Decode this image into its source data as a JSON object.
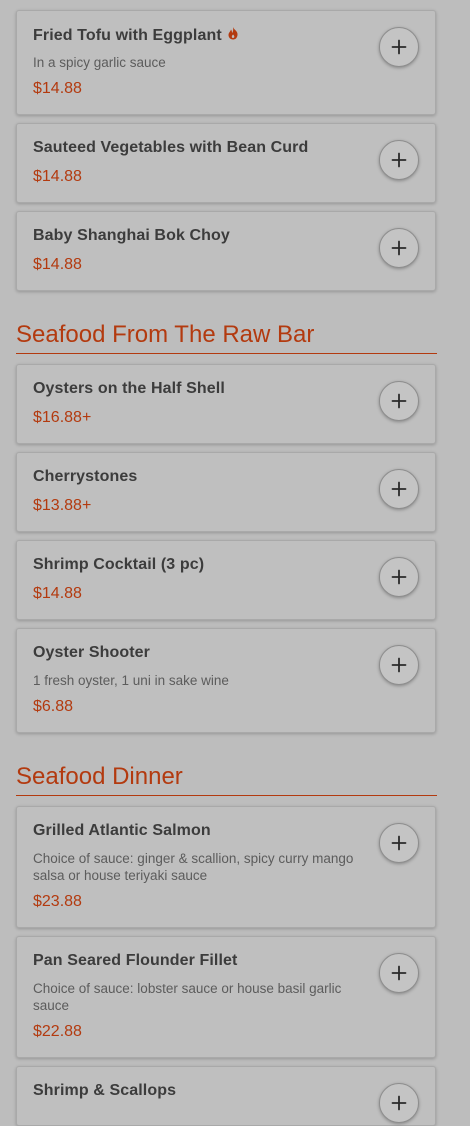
{
  "vegetable_items": [
    {
      "name": "Fried Tofu with Eggplant",
      "description": "In a spicy garlic sauce",
      "price": "$14.88",
      "spicy_icon": "flame-icon"
    },
    {
      "name": "Sauteed Vegetables with Bean Curd",
      "price": "$14.88"
    },
    {
      "name": "Baby Shanghai Bok Choy",
      "price": "$14.88"
    }
  ],
  "raw_bar": {
    "title": "Seafood From The Raw Bar",
    "items": [
      {
        "name": "Oysters on the Half Shell",
        "price": "$16.88+"
      },
      {
        "name": "Cherrystones",
        "price": "$13.88+"
      },
      {
        "name": "Shrimp Cocktail (3 pc)",
        "price": "$14.88"
      },
      {
        "name": "Oyster Shooter",
        "description": "1 fresh oyster, 1 uni in sake wine",
        "price": "$6.88"
      }
    ]
  },
  "seafood_dinner": {
    "title": "Seafood Dinner",
    "items": [
      {
        "name": "Grilled Atlantic Salmon",
        "description": "Choice of sauce: ginger & scallion, spicy curry mango salsa or house teriyaki sauce",
        "price": "$23.88"
      },
      {
        "name": "Pan Seared Flounder Fillet",
        "description": "Choice of sauce: lobster sauce or house basil garlic sauce",
        "price": "$22.88"
      },
      {
        "name": "Shrimp & Scallops"
      }
    ]
  },
  "colors": {
    "accent": "#b33a0f",
    "background": "#bdbdbd",
    "card": "#bfbfbf"
  },
  "add_button_icon": "plus-icon"
}
